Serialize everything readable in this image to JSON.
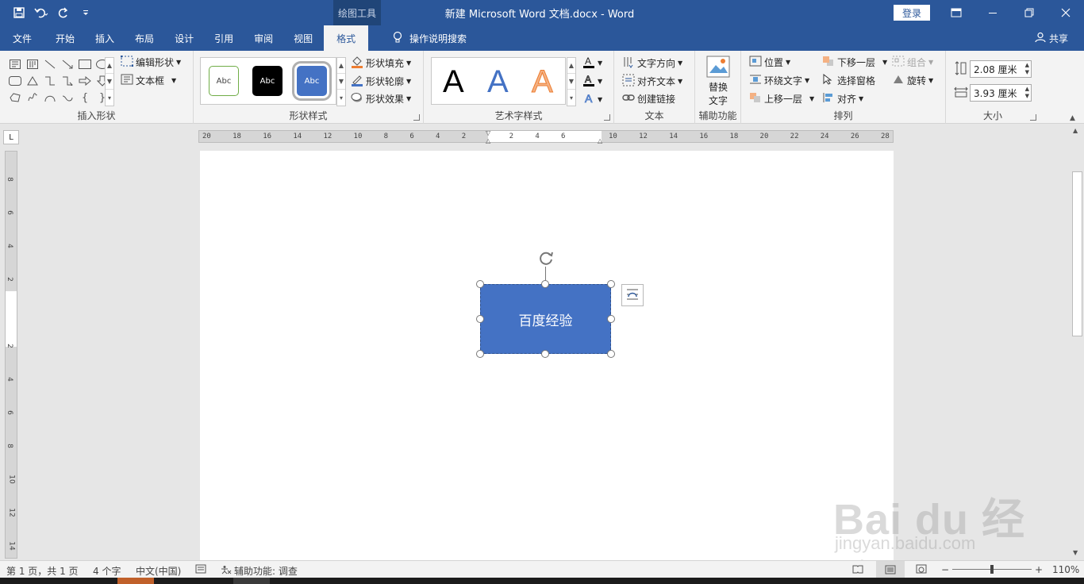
{
  "window": {
    "context_tool": "绘图工具",
    "title": "新建 Microsoft Word 文档.docx  -  Word",
    "login": "登录"
  },
  "tabs": [
    {
      "label": "文件"
    },
    {
      "label": "开始"
    },
    {
      "label": "插入"
    },
    {
      "label": "布局"
    },
    {
      "label": "设计"
    },
    {
      "label": "引用"
    },
    {
      "label": "审阅"
    },
    {
      "label": "视图"
    },
    {
      "label": "格式",
      "active": true
    }
  ],
  "tell_me": "操作说明搜索",
  "share": "共享",
  "ribbon": {
    "insert_shapes": {
      "label": "插入形状",
      "edit_shape": "编辑形状",
      "text_box": "文本框"
    },
    "shape_styles": {
      "label": "形状样式",
      "items": [
        "Abc",
        "Abc",
        "Abc"
      ],
      "fill": "形状填充",
      "outline": "形状轮廓",
      "effects": "形状效果"
    },
    "wordart": {
      "label": "艺术字样式",
      "items": [
        "A",
        "A",
        "A"
      ]
    },
    "text": {
      "label": "文本",
      "direction": "文字方向",
      "align": "对齐文本",
      "link": "创建链接"
    },
    "accessibility": {
      "label": "辅助功能",
      "alt_text_line1": "替换",
      "alt_text_line2": "文字"
    },
    "arrange": {
      "label": "排列",
      "position": "位置",
      "wrap_text": "环绕文字",
      "bring_forward": "上移一层",
      "send_backward": "下移一层",
      "selection_pane": "选择窗格",
      "align": "对齐",
      "group": "组合",
      "rotate": "旋转"
    },
    "size": {
      "label": "大小",
      "height": "2.08 厘米",
      "width": "3.93 厘米"
    }
  },
  "hruler_ticks": [
    "20",
    "18",
    "16",
    "14",
    "12",
    "10",
    "8",
    "6",
    "4",
    "2",
    "",
    "2",
    "4",
    "6",
    "",
    "10",
    "12",
    "14",
    "16",
    "18",
    "20",
    "22",
    "24",
    "26",
    "28"
  ],
  "vruler_ticks": [
    "8",
    "6",
    "4",
    "2",
    "",
    "2",
    "4",
    "6",
    "8",
    "10",
    "12",
    "14"
  ],
  "shape_text": "百度经验",
  "watermark": {
    "main": "Bai du 经验",
    "sub": "jingyan.baidu.com"
  },
  "status": {
    "page": "第 1 页，共 1 页",
    "words": "4 个字",
    "language": "中文(中国)",
    "accessibility": "辅助功能: 调查",
    "zoom": "110%"
  },
  "colors": {
    "title_bar": "#2b579a",
    "shape_fill": "#4472c4",
    "ribbon_bg": "#f3f3f3"
  }
}
